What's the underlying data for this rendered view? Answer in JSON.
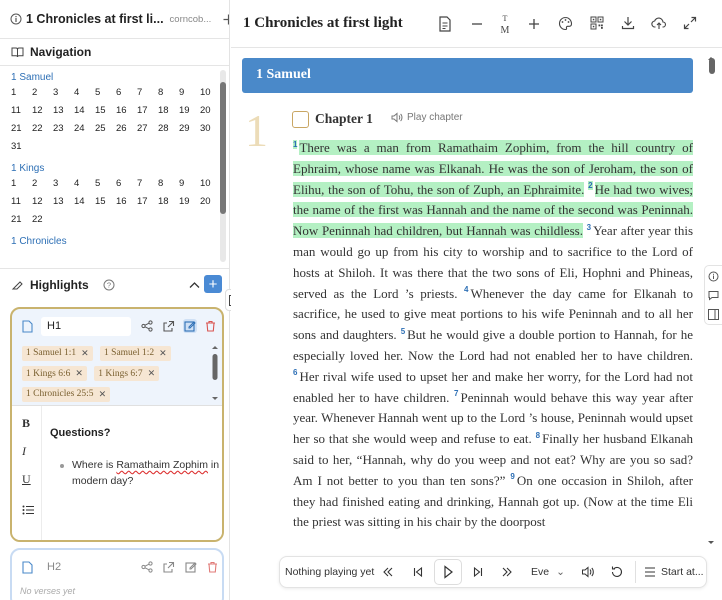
{
  "tab": {
    "title": "1 Chronicles at first li...",
    "subtitle": "corncob..."
  },
  "navigation": {
    "label": "Navigation",
    "books": [
      {
        "name": "1 Samuel",
        "chapters": [
          "1",
          "2",
          "3",
          "4",
          "5",
          "6",
          "7",
          "8",
          "9",
          "10",
          "11",
          "12",
          "13",
          "14",
          "15",
          "16",
          "17",
          "18",
          "19",
          "20",
          "21",
          "22",
          "23",
          "24",
          "25",
          "26",
          "27",
          "28",
          "29",
          "30",
          "31"
        ]
      },
      {
        "name": "1 Kings",
        "chapters": [
          "1",
          "2",
          "3",
          "4",
          "5",
          "6",
          "7",
          "8",
          "9",
          "10",
          "11",
          "12",
          "13",
          "14",
          "15",
          "16",
          "17",
          "18",
          "19",
          "20",
          "21",
          "22"
        ]
      },
      {
        "name": "1 Chronicles",
        "chapters": []
      }
    ]
  },
  "highlights": {
    "label": "Highlights",
    "add_label": "+",
    "cards": [
      {
        "name": "H1",
        "verses": [
          "1 Samuel 1:1",
          "1 Samuel 1:2",
          "1 Kings 6:6",
          "1 Kings 6:7",
          "1 Chronicles 25:5"
        ],
        "note_heading": "Questions?",
        "note_item_pre": "Where is ",
        "note_item_squiggle": "Ramathaim Zophim",
        "note_item_post": " in modern day?"
      },
      {
        "name": "H2",
        "empty_text": "No verses yet"
      }
    ],
    "format_buttons": {
      "bold": "B",
      "italic": "I",
      "underline": "U"
    }
  },
  "main": {
    "title": "1 Chronicles at first light",
    "book_banner": "1 Samuel",
    "chapter_number": "1",
    "chapter_title": "Chapter 1",
    "play_chapter": "Play chapter",
    "verses": [
      {
        "n": "1",
        "text": "There was a man from Ramathaim Zophim, from the hill country of Ephraim, whose name was Elkanah. He was the son of Jeroham, the son of Elihu, the son of Tohu, the son of Zuph, an Ephraimite.",
        "highlighted": true
      },
      {
        "n": "2",
        "text": "He had two wives; the name of the first was Hannah and the name of the second was Peninnah. Now Peninnah had children, but Hannah was childless.",
        "highlighted": true
      },
      {
        "n": "3",
        "text": "Year after year this man would go up from his city to worship and to sacrifice to the Lord of hosts at Shiloh. It was there that the two sons of Eli, Hophni and Phineas, served as the Lord ’s priests.",
        "highlighted": false
      },
      {
        "n": "4",
        "text": "Whenever the day came for Elkanah to sacrifice, he used to give meat portions to his wife Peninnah and to all her sons and daughters.",
        "highlighted": false
      },
      {
        "n": "5",
        "text": "But he would give a double portion to Hannah, for he especially loved her. Now the Lord had not enabled her to have children.",
        "highlighted": false
      },
      {
        "n": "6",
        "text": "Her rival wife used to upset her and make her worry, for the Lord had not enabled her to have children.",
        "highlighted": false
      },
      {
        "n": "7",
        "text": "Peninnah would behave this way year after year. Whenever Hannah went up to the Lord ’s house, Peninnah would upset her so that she would weep and refuse to eat.",
        "highlighted": false
      },
      {
        "n": "8",
        "text": "Finally her husband Elkanah said to her, “Hannah, why do you weep and not eat? Why are you so sad? Am I not better to you than ten sons?”",
        "highlighted": false
      },
      {
        "n": "9",
        "text": "On one occasion in Shiloh, after they had finished eating and drinking, Hannah got up. (Now at the time Eli the priest was sitting in his chair by the doorpost",
        "highlighted": false
      }
    ]
  },
  "player": {
    "status": "Nothing playing yet",
    "voice": "Eve",
    "start_at": "Start at..."
  },
  "colors": {
    "accent": "#4a89c9",
    "highlight": "#b4f0c3",
    "card_border": "#c9b36e",
    "tag_bg": "#f6e6d3"
  }
}
